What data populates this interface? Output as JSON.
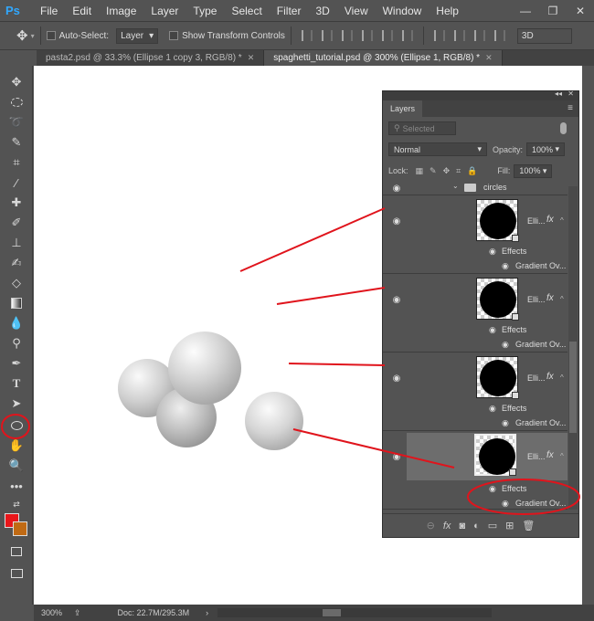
{
  "app": {
    "logo": "Ps",
    "menu": [
      "File",
      "Edit",
      "Image",
      "Layer",
      "Type",
      "Select",
      "Filter",
      "3D",
      "View",
      "Window",
      "Help"
    ],
    "window_controls": [
      "—",
      "❐",
      "✕"
    ]
  },
  "options_bar": {
    "auto_select_label": "Auto-Select:",
    "auto_select_value": "Layer",
    "show_transform_label": "Show Transform Controls",
    "mode_3d_label": "3D"
  },
  "tabs": [
    {
      "label": "pasta2.psd @ 33.3% (Ellipse 1 copy 3, RGB/8) *",
      "active": false
    },
    {
      "label": "spaghetti_tutorial.psd @ 300% (Ellipse 1, RGB/8) *",
      "active": true
    }
  ],
  "tools": [
    "move-icon",
    "marquee-icon",
    "lasso-icon",
    "quick-select-icon",
    "crop-icon",
    "eyedropper-icon",
    "healing-icon",
    "brush-icon",
    "stamp-icon",
    "history-brush-icon",
    "eraser-icon",
    "gradient-icon",
    "blur-icon",
    "dodge-icon",
    "pen-icon",
    "type-icon",
    "path-select-icon",
    "ellipse-icon",
    "hand-icon",
    "zoom-icon",
    "more-icon",
    "swap-colors-icon",
    "quick-mask-icon",
    "screen-mode-icon"
  ],
  "colors": {
    "foreground": "#e8161a",
    "background": "#c06a14",
    "annotation": "#e0141c",
    "accent": "#31a8ff"
  },
  "layers_panel": {
    "title": "Layers",
    "filter_placeholder": "Selected",
    "blend_mode": "Normal",
    "opacity_label": "Opacity:",
    "opacity_value": "100%",
    "lock_label": "Lock:",
    "fill_label": "Fill:",
    "fill_value": "100%",
    "group_name": "circles",
    "layers": [
      {
        "name": "Elli...",
        "fx": "fx",
        "effects_label": "Effects",
        "effect": "Gradient Ov...",
        "selected": false
      },
      {
        "name": "Elli...",
        "fx": "fx",
        "effects_label": "Effects",
        "effect": "Gradient Ov...",
        "selected": false
      },
      {
        "name": "Elli...",
        "fx": "fx",
        "effects_label": "Effects",
        "effect": "Gradient Ov...",
        "selected": false
      },
      {
        "name": "Elli...",
        "fx": "fx",
        "effects_label": "Effects",
        "effect": "Gradient Ov...",
        "selected": true
      }
    ]
  },
  "status_bar": {
    "zoom": "300%",
    "doc_info": "Doc: 22.7M/295.3M"
  }
}
